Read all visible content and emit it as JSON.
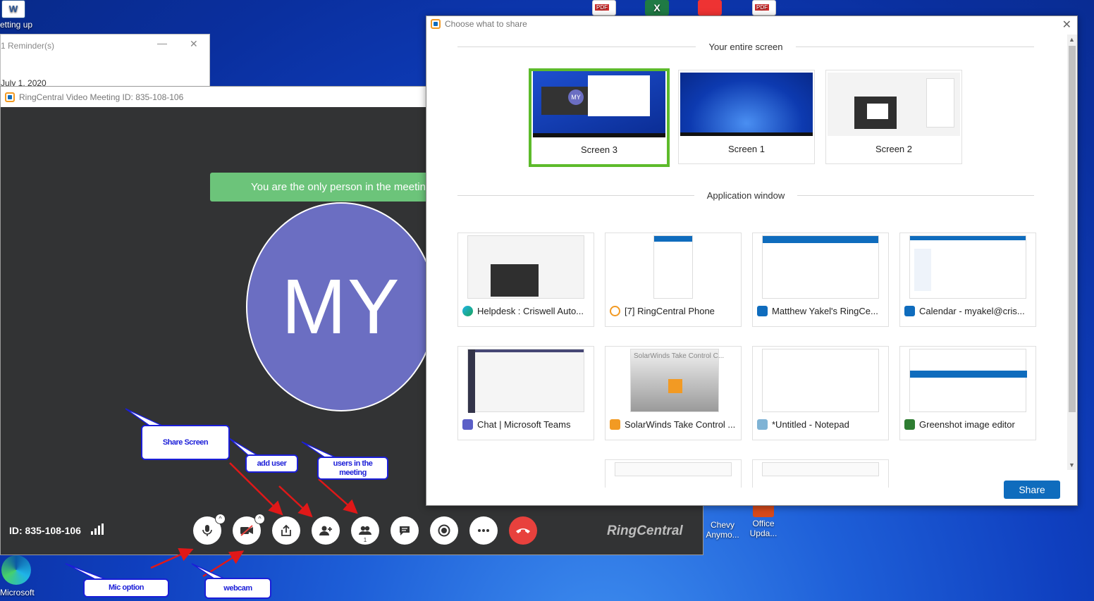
{
  "desktop": {
    "icons": [
      {
        "label": "Chevy\nAnymo...",
        "icon": "desktop-app-icon"
      },
      {
        "label": "Office\nUpda...",
        "icon": "office-icon"
      },
      {
        "label": "Microsoft",
        "icon": "edge-icon"
      },
      {
        "label": "etting up",
        "icon": "word-icon"
      }
    ]
  },
  "reminder": {
    "title": "1 Reminder(s)",
    "date": "July 1, 2020"
  },
  "meeting": {
    "title": "RingCentral Video Meeting ID: 835-108-106",
    "banner": "You are the only person in the meeting",
    "avatar_initials": "MY",
    "id_label": "ID: 835-108-106",
    "participant_count": "1",
    "brand": "RingCentral"
  },
  "callouts": {
    "share_screen": "Share Screen",
    "add_user": "add user",
    "users_in_meeting": "users in the meeting",
    "mic_option": "Mic option",
    "webcam": "webcam"
  },
  "dialog": {
    "title": "Choose what to share",
    "section_screen": "Your entire screen",
    "section_app": "Application window",
    "screens": [
      {
        "label": "Screen 3",
        "selected": true
      },
      {
        "label": "Screen 1",
        "selected": false
      },
      {
        "label": "Screen 2",
        "selected": false
      }
    ],
    "apps": [
      {
        "label": "Helpdesk : Criswell Auto...",
        "icon_color": "#1aa35a"
      },
      {
        "label": "[7] RingCentral Phone",
        "icon_color": "#f29a23"
      },
      {
        "label": "Matthew Yakel's RingCe...",
        "icon_color": "#0f6cbd"
      },
      {
        "label": "Calendar - myakel@cris...",
        "icon_color": "#0f6cbd"
      },
      {
        "label": "Chat | Microsoft Teams",
        "icon_color": "#5b5fc7"
      },
      {
        "label": "SolarWinds Take Control ...",
        "icon_color": "#f29a23"
      },
      {
        "label": "*Untitled - Notepad",
        "icon_color": "#7fb3d5"
      },
      {
        "label": "Greenshot image editor",
        "icon_color": "#2e7d32"
      }
    ],
    "solarwinds_thumb_text": "SolarWinds Take Control C...",
    "share_label": "Share"
  }
}
